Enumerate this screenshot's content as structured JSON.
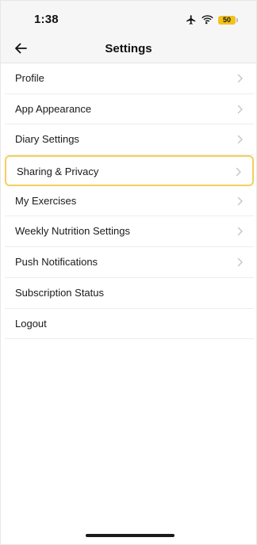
{
  "status_bar": {
    "time": "1:38",
    "battery_level": "50",
    "icons": [
      "airplane-icon",
      "wifi-icon",
      "battery-icon"
    ]
  },
  "header": {
    "title": "Settings",
    "back_icon": "arrow-left-icon"
  },
  "settings": {
    "items": [
      {
        "label": "Profile",
        "chevron": true
      },
      {
        "label": "App Appearance",
        "chevron": true
      },
      {
        "label": "Diary Settings",
        "chevron": true
      },
      {
        "label": "Sharing & Privacy",
        "chevron": true,
        "highlighted": true
      },
      {
        "label": "My Exercises",
        "chevron": true
      },
      {
        "label": "Weekly Nutrition Settings",
        "chevron": true
      },
      {
        "label": "Push Notifications",
        "chevron": true
      },
      {
        "label": "Subscription Status",
        "chevron": false
      },
      {
        "label": "Logout",
        "chevron": false
      }
    ]
  },
  "colors": {
    "highlight": "#f5cf5c",
    "battery": "#f2c21a",
    "chevron": "#c4c4c4"
  }
}
